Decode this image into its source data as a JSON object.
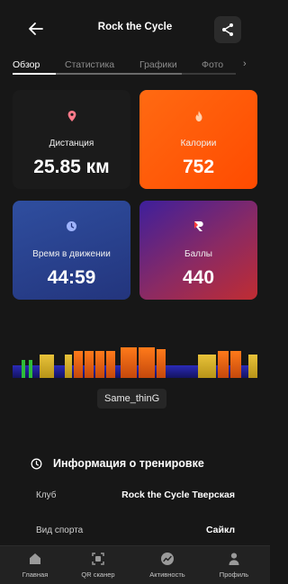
{
  "header": {
    "title": "Rock the Cycle"
  },
  "tabs": [
    {
      "label": "Обзор",
      "active": true
    },
    {
      "label": "Статистика",
      "active": false
    },
    {
      "label": "Графики",
      "active": false
    },
    {
      "label": "Фото",
      "active": false
    }
  ],
  "stats": {
    "distance": {
      "label": "Дистанция",
      "value": "25.85 км"
    },
    "calories": {
      "label": "Калории",
      "value": "752"
    },
    "moving_time": {
      "label": "Время в движении",
      "value": "44:59"
    },
    "points": {
      "label": "Баллы",
      "value": "440"
    }
  },
  "track": {
    "name": "Same_thinG"
  },
  "info": {
    "title": "Информация о тренировке",
    "rows": [
      {
        "label": "Клуб",
        "value": "Rock the Cycle Тверская"
      },
      {
        "label": "Вид спорта",
        "value": "Сайкл"
      }
    ]
  },
  "bottom_nav": [
    {
      "label": "Главная",
      "icon": "home-icon"
    },
    {
      "label": "QR сканер",
      "icon": "qr-scan-icon"
    },
    {
      "label": "Активность",
      "icon": "activity-icon"
    },
    {
      "label": "Профиль",
      "icon": "profile-icon"
    }
  ],
  "colors": {
    "background": "#171717",
    "calories_accent": "#ff5a0a",
    "time_card": "#2a3f8f",
    "points_gradient_start": "#3d1f9c",
    "points_gradient_end": "#c02c32",
    "distance_icon": "#ff7a8a",
    "baseline_blue": "#2a2ab8"
  }
}
